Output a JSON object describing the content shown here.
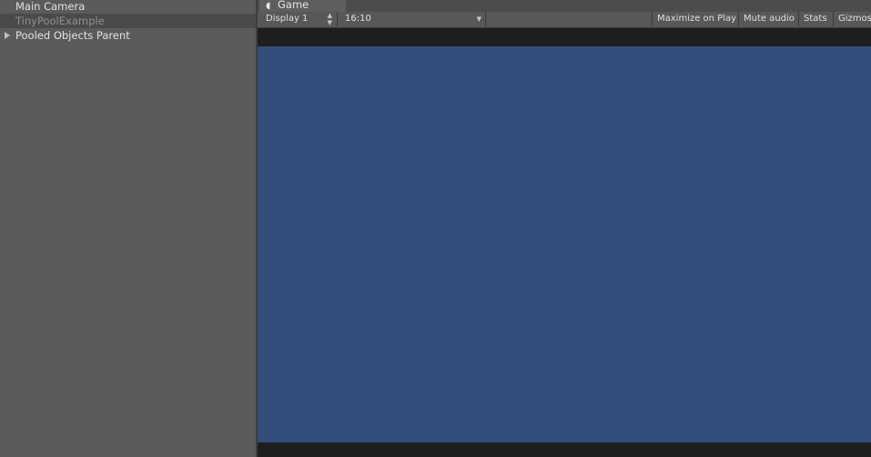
{
  "hierarchy": {
    "items": [
      {
        "label": "Main Camera",
        "selected": false,
        "has_children": false
      },
      {
        "label": "TinyPoolExample",
        "selected": true,
        "has_children": false
      },
      {
        "label": "Pooled Objects Parent",
        "selected": false,
        "has_children": true
      }
    ]
  },
  "game_panel": {
    "tab": {
      "label": "Game",
      "icon": "pacman-icon"
    },
    "toolbar": {
      "display": "Display 1",
      "aspect": "16:10",
      "maximize": "Maximize on Play",
      "mute": "Mute audio",
      "stats": "Stats",
      "gizmos": "Gizmos"
    },
    "viewport_color": "#314d79"
  },
  "colors": {
    "panel_bg": "#5b5b5b",
    "selected_row": "#4a4a4a",
    "letterbox": "#1e1e1e"
  }
}
